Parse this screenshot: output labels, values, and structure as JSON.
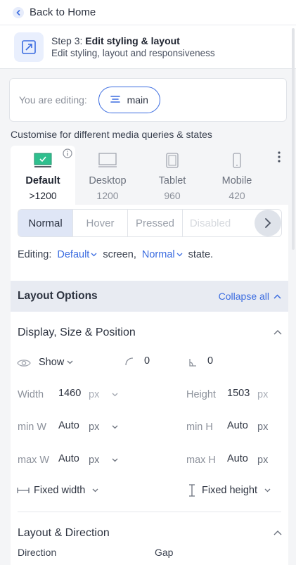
{
  "nav": {
    "back_label": "Back to Home"
  },
  "step": {
    "prefix": "Step 3:",
    "title": "Edit styling & layout",
    "subtitle": "Edit styling, layout and responsiveness"
  },
  "editing": {
    "label": "You are editing:",
    "element": "main"
  },
  "customise_label": "Customise for different media queries & states",
  "media_queries": [
    {
      "name": "Default",
      "size": ">1200",
      "icon": "checkbox-screen-icon",
      "active": true
    },
    {
      "name": "Desktop",
      "size": "1200",
      "icon": "desktop-icon"
    },
    {
      "name": "Tablet",
      "size": "960",
      "icon": "tablet-icon"
    },
    {
      "name": "Mobile",
      "size": "420",
      "icon": "mobile-icon"
    }
  ],
  "states": [
    "Normal",
    "Hover",
    "Pressed",
    "Disabled"
  ],
  "editing_line": {
    "prefix": "Editing:",
    "screen": "Default",
    "screen_suffix": "screen,",
    "state": "Normal",
    "state_suffix": "state."
  },
  "layout_options": {
    "title": "Layout Options",
    "collapse_label": "Collapse all"
  },
  "display_section": {
    "title": "Display, Size & Position",
    "visibility": "Show",
    "radius": "0",
    "rotation": "0",
    "width": {
      "label": "Width",
      "value": "1460",
      "unit": "px"
    },
    "height": {
      "label": "Height",
      "value": "1503",
      "unit": "px"
    },
    "min_w": {
      "label": "min W",
      "value": "Auto",
      "unit": "px"
    },
    "min_h": {
      "label": "min H",
      "value": "Auto",
      "unit": "px"
    },
    "max_w": {
      "label": "max W",
      "value": "Auto",
      "unit": "px"
    },
    "max_h": {
      "label": "max H",
      "value": "Auto",
      "unit": "px"
    },
    "fixed_width": "Fixed width",
    "fixed_height": "Fixed height"
  },
  "direction_section": {
    "title": "Layout & Direction",
    "direction_label": "Direction",
    "gap_label": "Gap"
  },
  "colors": {
    "accent": "#3b6ce0",
    "active_state_bg": "#dfe6f6",
    "check_green": "#2fbf8e"
  }
}
